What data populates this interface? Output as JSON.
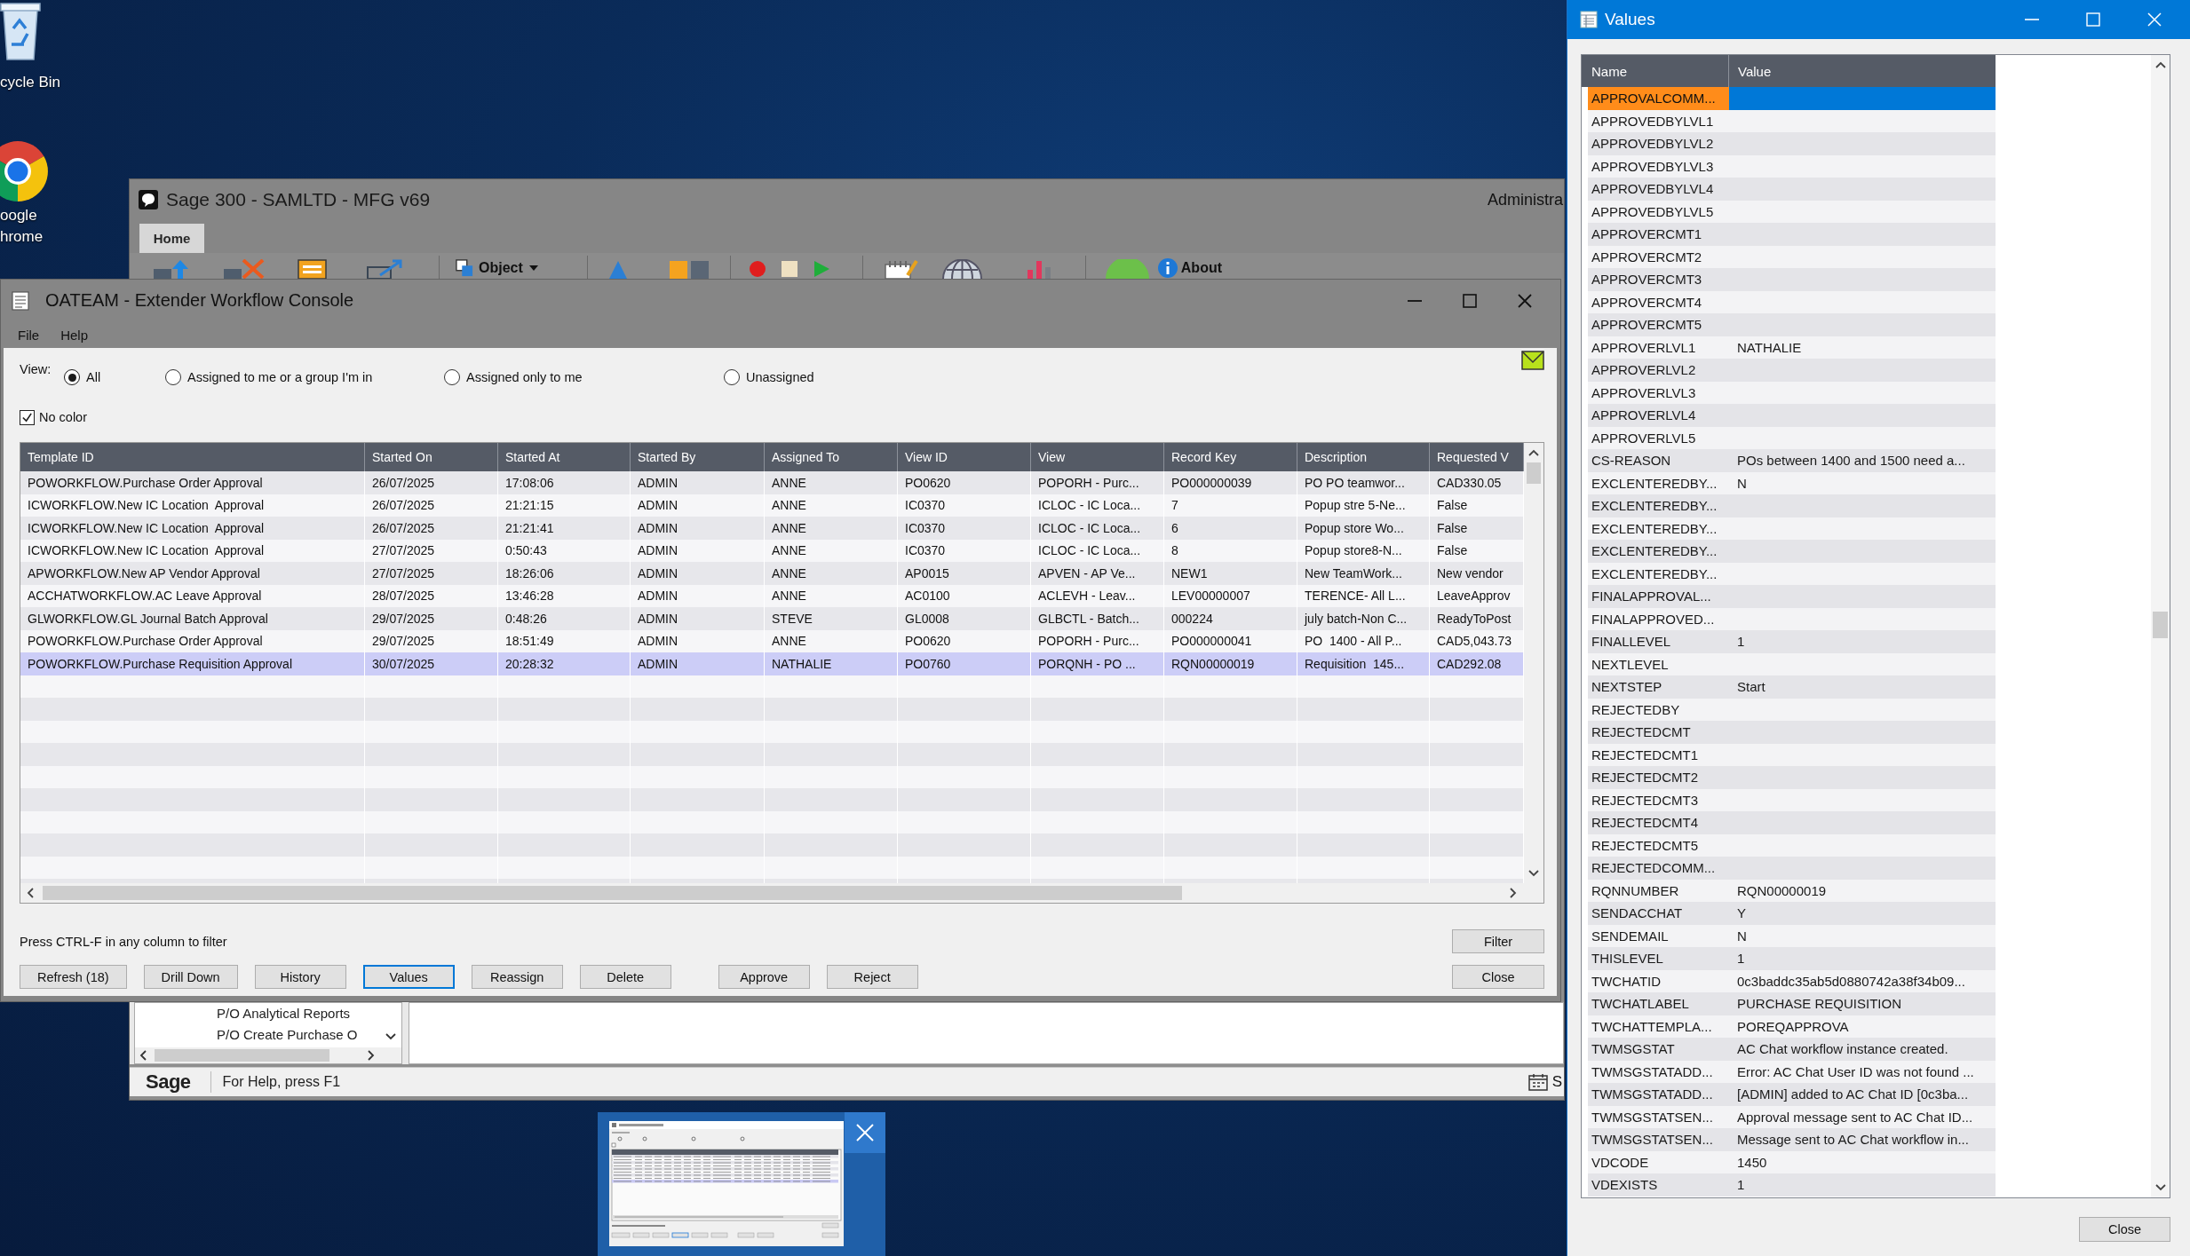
{
  "desktop_icons": [
    {
      "kind": "bin",
      "label_lines": [
        "cycle Bin"
      ]
    },
    {
      "kind": "browser",
      "label_lines": [
        "oogle",
        "hrome"
      ]
    }
  ],
  "sage_window": {
    "title": "Sage 300 - SAMLTD - MFG v69",
    "user_label": "Administra",
    "tabs": [
      {
        "label": "Home",
        "selected": true
      }
    ],
    "toolbar": {
      "object_button": "Object",
      "about_button": "About"
    },
    "nav_items": [
      "P/O Analytical Reports",
      "P/O Create Purchase O"
    ],
    "status_bar": {
      "logo": "Sage",
      "help_text": "For Help, press F1",
      "right_text": "S"
    }
  },
  "console": {
    "title": "OATEAM - Extender Workflow Console",
    "menu": [
      "File",
      "Help"
    ],
    "view_label": "View:",
    "view_options": [
      {
        "label": "All",
        "selected": true
      },
      {
        "label": "Assigned to me or a group I'm in",
        "selected": false
      },
      {
        "label": "Assigned only to me",
        "selected": false
      },
      {
        "label": "Unassigned",
        "selected": false
      }
    ],
    "no_color": {
      "label": "No color",
      "checked": true
    },
    "table": {
      "columns": [
        "Template ID",
        "Started On",
        "Started At",
        "Started By",
        "Assigned To",
        "View ID",
        "View",
        "Record Key",
        "Description",
        "Requested V"
      ],
      "rows": [
        {
          "cells": [
            "POWORKFLOW.Purchase Order Approval",
            "26/07/2025",
            "17:08:06",
            "ADMIN",
            "ANNE",
            "PO0620",
            "POPORH - Purc...",
            "PO000000039",
            "PO PO teamwor...",
            "CAD330.05"
          ],
          "selected": false
        },
        {
          "cells": [
            "ICWORKFLOW.New IC Location  Approval",
            "26/07/2025",
            "21:21:15",
            "ADMIN",
            "ANNE",
            "IC0370",
            "ICLOC - IC Loca...",
            "7",
            "Popup stre 5-Ne...",
            "False"
          ],
          "selected": false
        },
        {
          "cells": [
            "ICWORKFLOW.New IC Location  Approval",
            "26/07/2025",
            "21:21:41",
            "ADMIN",
            "ANNE",
            "IC0370",
            "ICLOC - IC Loca...",
            "6",
            "Popup store Wo...",
            "False"
          ],
          "selected": false
        },
        {
          "cells": [
            "ICWORKFLOW.New IC Location  Approval",
            "27/07/2025",
            "0:50:43",
            "ADMIN",
            "ANNE",
            "IC0370",
            "ICLOC - IC Loca...",
            "8",
            "Popup store8-N...",
            "False"
          ],
          "selected": false
        },
        {
          "cells": [
            "APWORKFLOW.New AP Vendor Approval",
            "27/07/2025",
            "18:26:06",
            "ADMIN",
            "ANNE",
            "AP0015",
            "APVEN - AP Ve...",
            "NEW1",
            "New TeamWork...",
            "New vendor"
          ],
          "selected": false
        },
        {
          "cells": [
            "ACCHATWORKFLOW.AC Leave Approval",
            "28/07/2025",
            "13:46:28",
            "ADMIN",
            "ANNE",
            "AC0100",
            "ACLEVH - Leav...",
            "LEV00000007",
            "TERENCE- All L...",
            "LeaveApprov"
          ],
          "selected": false
        },
        {
          "cells": [
            "GLWORKFLOW.GL Journal Batch Approval",
            "29/07/2025",
            "0:48:26",
            "ADMIN",
            "STEVE",
            "GL0008",
            "GLBCTL - Batch...",
            "000224",
            "july batch-Non C...",
            "ReadyToPost"
          ],
          "selected": false
        },
        {
          "cells": [
            "POWORKFLOW.Purchase Order Approval",
            "29/07/2025",
            "18:51:49",
            "ADMIN",
            "ANNE",
            "PO0620",
            "POPORH - Purc...",
            "PO000000041",
            "PO  1400 - All P...",
            "CAD5,043.73"
          ],
          "selected": false
        },
        {
          "cells": [
            "POWORKFLOW.Purchase Requisition Approval",
            "30/07/2025",
            "20:28:32",
            "ADMIN",
            "NATHALIE",
            "PO0760",
            "PORQNH - PO ...",
            "RQN00000019",
            "Requisition  145...",
            "CAD292.08"
          ],
          "selected": true
        }
      ]
    },
    "hint": "Press CTRL-F in any column to filter",
    "filter_button": {
      "label": "Filter",
      "focused": false
    },
    "action_groups": [
      {
        "buttons": [
          {
            "label": "Refresh (18)",
            "focused": false
          },
          {
            "label": "Drill Down",
            "focused": false
          },
          {
            "label": "History",
            "focused": false
          },
          {
            "label": "Values",
            "focused": true
          },
          {
            "label": "Reassign",
            "focused": false
          },
          {
            "label": "Delete",
            "focused": false
          }
        ]
      },
      {
        "buttons": [
          {
            "label": "Approve",
            "focused": false
          },
          {
            "label": "Reject",
            "focused": false
          }
        ]
      }
    ],
    "close_button": {
      "label": "Close",
      "focused": false
    }
  },
  "values_window": {
    "title": "Values",
    "columns": [
      "Name",
      "Value"
    ],
    "rows": [
      {
        "name": "APPROVALCOMM...",
        "selected": true
      },
      {
        "name": "APPROVEDBYLVL1",
        "selected": false
      },
      {
        "name": "APPROVEDBYLVL2",
        "selected": false
      },
      {
        "name": "APPROVEDBYLVL3",
        "selected": false
      },
      {
        "name": "APPROVEDBYLVL4",
        "selected": false
      },
      {
        "name": "APPROVEDBYLVL5",
        "selected": false
      },
      {
        "name": "APPROVERCMT1",
        "selected": false
      },
      {
        "name": "APPROVERCMT2",
        "selected": false
      },
      {
        "name": "APPROVERCMT3",
        "selected": false
      },
      {
        "name": "APPROVERCMT4",
        "selected": false
      },
      {
        "name": "APPROVERCMT5",
        "selected": false
      },
      {
        "name": "APPROVERLVL1",
        "value": "NATHALIE",
        "selected": false
      },
      {
        "name": "APPROVERLVL2",
        "selected": false
      },
      {
        "name": "APPROVERLVL3",
        "selected": false
      },
      {
        "name": "APPROVERLVL4",
        "selected": false
      },
      {
        "name": "APPROVERLVL5",
        "selected": false
      },
      {
        "name": "CS-REASON",
        "value": "POs between 1400 and 1500 need a...",
        "selected": false
      },
      {
        "name": "EXCLENTEREDBY...",
        "value": "N",
        "selected": false
      },
      {
        "name": "EXCLENTEREDBY...",
        "selected": false
      },
      {
        "name": "EXCLENTEREDBY...",
        "selected": false
      },
      {
        "name": "EXCLENTEREDBY...",
        "selected": false
      },
      {
        "name": "EXCLENTEREDBY...",
        "selected": false
      },
      {
        "name": "FINALAPPROVAL...",
        "selected": false
      },
      {
        "name": "FINALAPPROVED...",
        "selected": false
      },
      {
        "name": "FINALLEVEL",
        "value": "1",
        "selected": false
      },
      {
        "name": "NEXTLEVEL",
        "selected": false
      },
      {
        "name": "NEXTSTEP",
        "value": "Start",
        "selected": false
      },
      {
        "name": "REJECTEDBY",
        "selected": false
      },
      {
        "name": "REJECTEDCMT",
        "selected": false
      },
      {
        "name": "REJECTEDCMT1",
        "selected": false
      },
      {
        "name": "REJECTEDCMT2",
        "selected": false
      },
      {
        "name": "REJECTEDCMT3",
        "selected": false
      },
      {
        "name": "REJECTEDCMT4",
        "selected": false
      },
      {
        "name": "REJECTEDCMT5",
        "selected": false
      },
      {
        "name": "REJECTEDCOMM...",
        "selected": false
      },
      {
        "name": "RQNNUMBER",
        "value": "RQN00000019",
        "selected": false
      },
      {
        "name": "SENDACCHAT",
        "value": "Y",
        "selected": false
      },
      {
        "name": "SENDEMAIL",
        "value": "N",
        "selected": false
      },
      {
        "name": "THISLEVEL",
        "value": "1",
        "selected": false
      },
      {
        "name": "TWCHATID",
        "value": "0c3baddc35ab5d0880742a38f34b09...",
        "selected": false
      },
      {
        "name": "TWCHATLABEL",
        "value": "PURCHASE REQUISITION",
        "selected": false
      },
      {
        "name": "TWCHATTEMPLA...",
        "value": "POREQAPPROVA",
        "selected": false
      },
      {
        "name": "TWMSGSTAT",
        "value": "AC Chat workflow instance created.",
        "selected": false
      },
      {
        "name": "TWMSGSTATADD...",
        "value": "Error: AC Chat User ID was not found ...",
        "selected": false
      },
      {
        "name": "TWMSGSTATADD...",
        "value": "[ADMIN] added to AC Chat ID [0c3ba...",
        "selected": false
      },
      {
        "name": "TWMSGSTATSEN...",
        "value": "Approval message sent to AC Chat ID...",
        "selected": false
      },
      {
        "name": "TWMSGSTATSEN...",
        "value": "Message sent to AC Chat workflow in...",
        "selected": false
      },
      {
        "name": "VDCODE",
        "value": "1450",
        "selected": false
      },
      {
        "name": "VDEXISTS",
        "value": "1",
        "selected": false
      }
    ],
    "close_button": "Close"
  }
}
